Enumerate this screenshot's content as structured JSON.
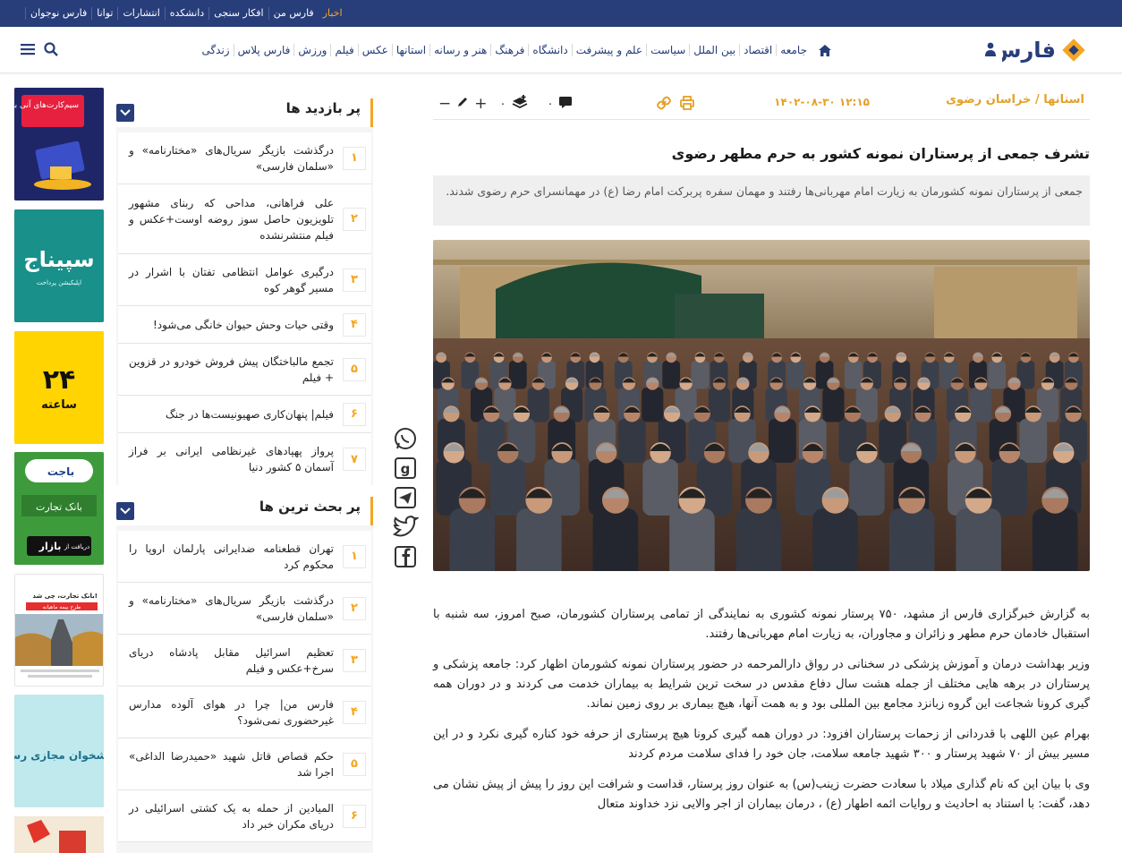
{
  "top_links": [
    "اخبار",
    "فارس من",
    "افکار سنجی",
    "دانشکده",
    "انتشارات",
    "توانا",
    "فارس نوجوان"
  ],
  "logo_text": "فارس",
  "nav": [
    "جامعه",
    "اقتصاد",
    "بین الملل",
    "سیاست",
    "علم و پیشرفت",
    "دانشگاه",
    "فرهنگ",
    "هنر و رسانه",
    "استانها",
    "عکس",
    "فیلم",
    "ورزش",
    "فارس پلاس",
    "زندگی"
  ],
  "article": {
    "breadcrumb": "استانها / خراسان رضوی",
    "datetime": "۱۴۰۲-۰۸-۳۰ ۱۲:۱۵",
    "comment_count": "۰",
    "save_count": "۰",
    "title": "تشرف جمعی از پرستاران نمونه کشور به حرم مطهر رضوی",
    "lead": "جمعی از پرستاران نمونه کشورمان به زیارت امام مهربانی‌ها رفتند و مهمان سفره پربرکت امام رضا (ع) در مهمانسرای حرم رضوی شدند.",
    "paragraphs": [
      "به گزارش خبرگزاری فارس از مشهد، ۷۵۰ پرستار نمونه کشوری به نمایندگی از تمامی پرستاران کشورمان، صبح امروز، سه شنبه با استقبال خادمان حرم مطهر و زائران و مجاوران، به زیارت امام مهربانی‌ها رفتند.",
      "وزیر بهداشت درمان و آموزش پزشکی در سخنانی در رواق دارالمرحمه در حضور پرستاران نمونه کشورمان اظهار کرد: جامعه پزشکی و پرستاران در برهه هایی مختلف از جمله هشت سال دفاع مقدس در سخت ترین شرایط به بیماران خدمت می کردند و در دوران همه گیری کرونا شجاعت این گروه زبانزد مجامع بین المللی بود و به همت آنها، هیچ بیماری بر روی زمین نماند.",
      "بهرام عین اللهی با قدردانی از زحمات پرستاران افزود: در دوران همه گیری کرونا هیچ پرستاری از حرفه خود کناره گیری نکرد و در این مسیر بیش از ۷۰ شهید پرستار و ۳۰۰ شهید جامعه سلامت، جان خود را فدای سلامت مردم کردند",
      "وی با بیان این که نام گذاری میلاد با سعادت حضرت زینب(س) به عنوان روز پرستار، قداست و شرافت این روز را پیش از پیش نشان می دهد، گفت: با استناد به احادیث و روایات ائمه اطهار (ع) ، درمان بیماران از اجر والایی نزد خداوند متعال"
    ]
  },
  "most_visited": {
    "title": "پر بازدید ها",
    "items": [
      {
        "num": "۱",
        "text": "درگذشت بازیگر سریال‌های «مختارنامه» و «سلمان فارسی»"
      },
      {
        "num": "۲",
        "text": "علی فراهانی، مداحی که ربنای مشهور تلویزیون حاصل سوز روضه اوست+عکس و فیلم منتشرنشده"
      },
      {
        "num": "۳",
        "text": "درگیری عوامل انتظامی تفتان با اشرار در مسیر گوهر کوه"
      },
      {
        "num": "۴",
        "text": "وقتی حیات وحش حیوان خانگی می‌شود!"
      },
      {
        "num": "۵",
        "text": "تجمع مالباختگان پیش فروش خودرو در قزوین + فیلم"
      },
      {
        "num": "۶",
        "text": "فیلم| پنهان‌کاری صهیونیست‌ها در جنگ"
      },
      {
        "num": "۷",
        "text": "پرواز پهپادهای غیرنظامی ایرانی بر فراز آسمان ۵ کشور دنیا"
      }
    ]
  },
  "most_discussed": {
    "title": "پر بحث ترین ها",
    "items": [
      {
        "num": "۱",
        "text": "تهران قطعنامه ضدایرانی پارلمان اروپا را محکوم کرد"
      },
      {
        "num": "۲",
        "text": "درگذشت بازیگر سریال‌های «مختارنامه» و «سلمان فارسی»"
      },
      {
        "num": "۳",
        "text": "تعظیم اسرائیل مقابل پادشاه دریای سرخ+عکس و فیلم"
      },
      {
        "num": "۴",
        "text": "فارس من| چرا در هوای آلوده مدارس غیرحضوری نمی‌شود؟"
      },
      {
        "num": "۵",
        "text": "حکم قصاص قاتل شهید «حمیدرضا الداغی» اجرا شد"
      },
      {
        "num": "۶",
        "text": "المیادین از حمله به یک کشتی اسرائیلی در دریای مکران خبر داد"
      }
    ]
  },
  "ads": {
    "sim": "سیم‌کارت‌های آنی با بسته‌های ویژه",
    "sepinaj": "سپیناج",
    "sepinaj_sub": "اپلیکیشن پرداخت",
    "hours": "۲۴",
    "hours_word": "ساعته",
    "bajet": "باجت",
    "bank": "بانک تجارت",
    "bazar_small": "دریافت از",
    "bazar": "بازار",
    "bank_ad": "بانک تجارت، چی شد!",
    "bank_ad_sub": "طرح بیمه ماهیانه",
    "pishkhan": "با پیشخوان مجازی رسالت"
  },
  "colors": {
    "topbar": "#283e7a",
    "accent": "#f5a623",
    "nav_text": "#243b7a"
  }
}
